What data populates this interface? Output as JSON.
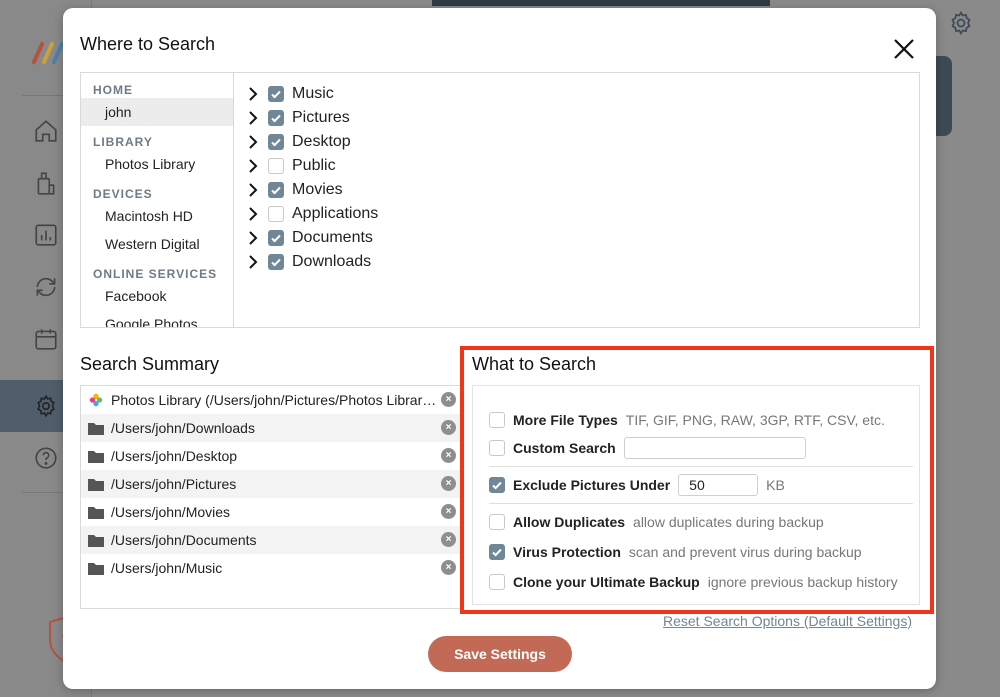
{
  "colors": {
    "accent": "#6f8797",
    "highlight": "#f23418",
    "save": "#c26a56"
  },
  "modal": {
    "title": "Where to Search",
    "close_icon": "close-icon"
  },
  "sources": {
    "home_heading": "HOME",
    "home_items": [
      "john"
    ],
    "library_heading": "LIBRARY",
    "library_items": [
      "Photos Library"
    ],
    "devices_heading": "DEVICES",
    "devices_items": [
      "Macintosh HD",
      "Western Digital"
    ],
    "online_heading": "ONLINE SERVICES",
    "online_items": [
      "Facebook",
      "Google Photos"
    ],
    "selected": "john"
  },
  "folders": [
    {
      "label": "Music",
      "checked": true
    },
    {
      "label": "Pictures",
      "checked": true
    },
    {
      "label": "Desktop",
      "checked": true
    },
    {
      "label": "Public",
      "checked": false
    },
    {
      "label": "Movies",
      "checked": true
    },
    {
      "label": "Applications",
      "checked": false
    },
    {
      "label": "Documents",
      "checked": true
    },
    {
      "label": "Downloads",
      "checked": true
    }
  ],
  "summary": {
    "title": "Search Summary",
    "items": [
      {
        "text": "Photos Library (/Users/john/Pictures/Photos Library.photoslibrary)",
        "icon": "photos-icon"
      },
      {
        "text": "/Users/john/Downloads",
        "icon": "folder-icon"
      },
      {
        "text": "/Users/john/Desktop",
        "icon": "folder-icon"
      },
      {
        "text": "/Users/john/Pictures",
        "icon": "folder-icon"
      },
      {
        "text": "/Users/john/Movies",
        "icon": "folder-icon"
      },
      {
        "text": "/Users/john/Documents",
        "icon": "folder-icon"
      },
      {
        "text": "/Users/john/Music",
        "icon": "folder-icon"
      }
    ]
  },
  "what": {
    "title": "What to Search",
    "more_types": {
      "label": "More File Types",
      "desc": "TIF, GIF, PNG, RAW, 3GP, RTF, CSV, etc.",
      "checked": false
    },
    "custom_search": {
      "label": "Custom Search",
      "value": "",
      "checked": false
    },
    "exclude": {
      "label": "Exclude Pictures Under",
      "value": "50",
      "unit": "KB",
      "checked": true
    },
    "duplicates": {
      "label": "Allow Duplicates",
      "desc": "allow duplicates during backup",
      "checked": false
    },
    "virus": {
      "label": "Virus Protection",
      "desc": "scan and prevent virus during backup",
      "checked": true
    },
    "clone": {
      "label": "Clone your Ultimate Backup",
      "desc": "ignore previous backup history",
      "checked": false
    }
  },
  "reset_link": "Reset Search Options (Default Settings)",
  "save_button": "Save Settings"
}
